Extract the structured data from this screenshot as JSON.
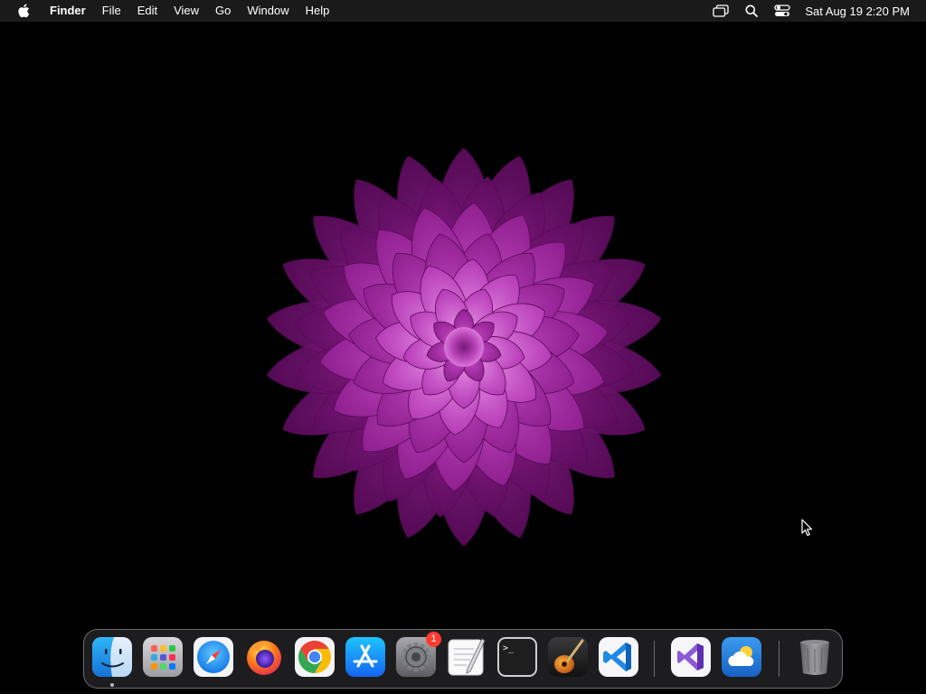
{
  "menubar": {
    "app_name": "Finder",
    "menus": [
      "File",
      "Edit",
      "View",
      "Go",
      "Window",
      "Help"
    ],
    "status_icons": [
      "screen-mirroring-icon",
      "spotlight-search-icon",
      "control-center-icon"
    ],
    "clock": "Sat Aug 19  2:20 PM"
  },
  "dock": {
    "apps": [
      {
        "name": "Finder",
        "icon": "finder-icon",
        "running": true
      },
      {
        "name": "Launchpad",
        "icon": "launchpad-icon"
      },
      {
        "name": "Safari",
        "icon": "safari-icon"
      },
      {
        "name": "Firefox",
        "icon": "firefox-icon"
      },
      {
        "name": "Google Chrome",
        "icon": "chrome-icon"
      },
      {
        "name": "App Store",
        "icon": "app-store-icon"
      },
      {
        "name": "System Settings",
        "icon": "system-settings-icon",
        "badge": "1"
      },
      {
        "name": "TextEdit",
        "icon": "textedit-icon"
      },
      {
        "name": "Terminal",
        "icon": "terminal-icon",
        "prompt": ">_"
      },
      {
        "name": "GarageBand",
        "icon": "garageband-icon"
      },
      {
        "name": "Visual Studio Code",
        "icon": "vscode-icon"
      },
      {
        "name": "Visual Studio",
        "icon": "visual-studio-icon"
      },
      {
        "name": "Weather",
        "icon": "weather-icon"
      },
      {
        "name": "Trash",
        "icon": "trash-icon"
      }
    ]
  },
  "colors": {
    "menubar_bg": "#1a1a1a",
    "wallpaper_bg": "#000000",
    "flower_outer": "#8e1c8e",
    "flower_mid": "#c13fc1",
    "flower_inner": "#e07ae0",
    "badge": "#ff3b30"
  }
}
